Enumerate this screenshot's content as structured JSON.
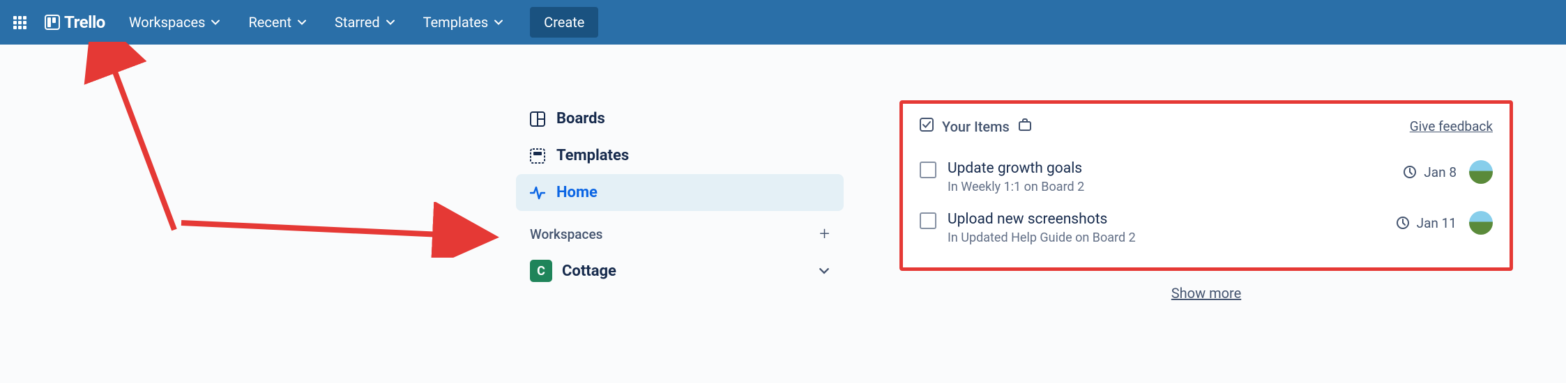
{
  "brand": "Trello",
  "nav": {
    "workspaces": "Workspaces",
    "recent": "Recent",
    "starred": "Starred",
    "templates": "Templates",
    "create": "Create"
  },
  "sidebar": {
    "items": [
      {
        "label": "Boards"
      },
      {
        "label": "Templates"
      },
      {
        "label": "Home"
      }
    ],
    "section_label": "Workspaces",
    "workspaces": [
      {
        "badge": "C",
        "name": "Cottage"
      }
    ]
  },
  "panel": {
    "title": "Your Items",
    "feedback": "Give feedback",
    "items": [
      {
        "title": "Update growth goals",
        "sub": "In Weekly 1:1 on Board 2",
        "date": "Jan 8"
      },
      {
        "title": "Upload new screenshots",
        "sub": "In Updated Help Guide on Board 2",
        "date": "Jan 11"
      }
    ],
    "show_more": "Show more"
  },
  "colors": {
    "navbar_bg": "#2a6fa8",
    "accent": "#0c66e4",
    "annotation": "#e53935"
  }
}
